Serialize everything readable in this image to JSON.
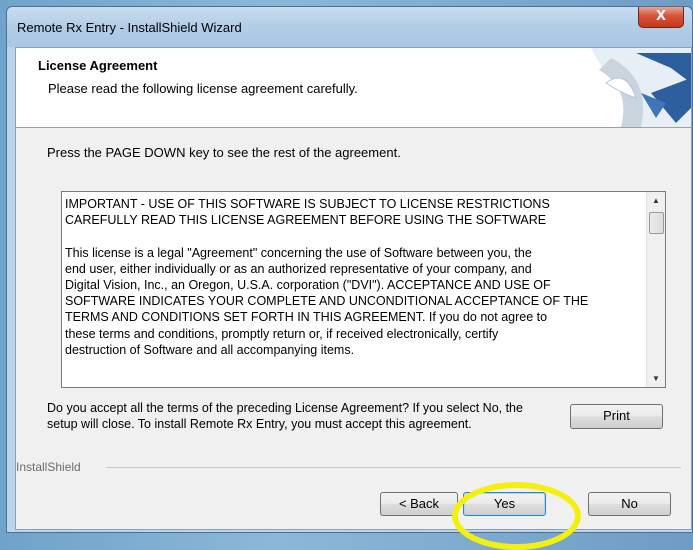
{
  "window": {
    "title": "Remote Rx Entry - InstallShield Wizard",
    "close_label": "X"
  },
  "header": {
    "title": "License Agreement",
    "subtitle": "Please read the following license agreement carefully."
  },
  "instruction": "Press the PAGE DOWN key to see the rest of the agreement.",
  "license": {
    "text": "IMPORTANT - USE OF THIS SOFTWARE IS SUBJECT TO LICENSE RESTRICTIONS\nCAREFULLY READ THIS LICENSE AGREEMENT BEFORE USING THE SOFTWARE\n\nThis license is a legal \"Agreement\" concerning the use of Software between you, the\nend user, either individually or as an authorized representative of your company, and\nDigital Vision, Inc., an Oregon, U.S.A. corporation (\"DVI\"). ACCEPTANCE AND USE OF\nSOFTWARE INDICATES YOUR COMPLETE AND UNCONDITIONAL ACCEPTANCE OF THE\nTERMS AND CONDITIONS SET FORTH IN THIS AGREEMENT. If you do not agree to\nthese terms and conditions, promptly return or, if received electronically, certify\ndestruction of Software and all accompanying items."
  },
  "accept_question": "Do you accept all the terms of the preceding License Agreement?  If you select No,  the setup will close.  To install Remote Rx Entry, you must accept this agreement.",
  "buttons": {
    "print": "Print",
    "back": "< Back",
    "yes": "Yes",
    "no": "No"
  },
  "footer_label": "InstallShield",
  "colors": {
    "highlight": "#f3f011",
    "logo_blue": "#2d5f9e"
  }
}
